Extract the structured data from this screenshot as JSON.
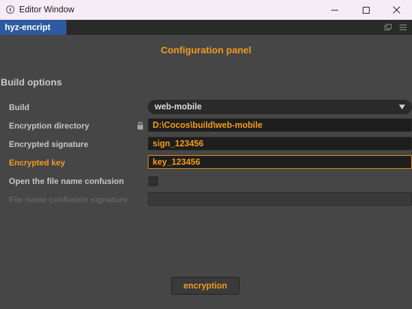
{
  "window": {
    "title": "Editor Window",
    "icons": [
      "app-icon",
      "minimize-icon",
      "maximize-icon",
      "close-icon"
    ]
  },
  "tab": {
    "label": "hyz-encript",
    "icons": [
      "popout-icon",
      "menu-icon"
    ]
  },
  "panel": {
    "title": "Configuration panel",
    "section": "Build options"
  },
  "fields": {
    "build": {
      "label": "Build",
      "value": "web-mobile"
    },
    "encryption_directory": {
      "label": "Encryption directory",
      "value": "D:\\Cocos\\build\\web-mobile"
    },
    "encrypted_signature": {
      "label": "Encrypted signature",
      "value": "sign_123456"
    },
    "encrypted_key": {
      "label": "Encrypted key",
      "value": "key_123456"
    },
    "file_name_confusion": {
      "label": "Open the file name confusion",
      "checked": false
    },
    "file_name_confusion_signature": {
      "label": "File name confusion signature",
      "value": ""
    }
  },
  "actions": {
    "encrypt_label": "encryption"
  },
  "colors": {
    "accent": "#f29b22",
    "tab_active": "#2d5aa0",
    "background": "#464646",
    "field_bg": "#1e1e1e"
  }
}
